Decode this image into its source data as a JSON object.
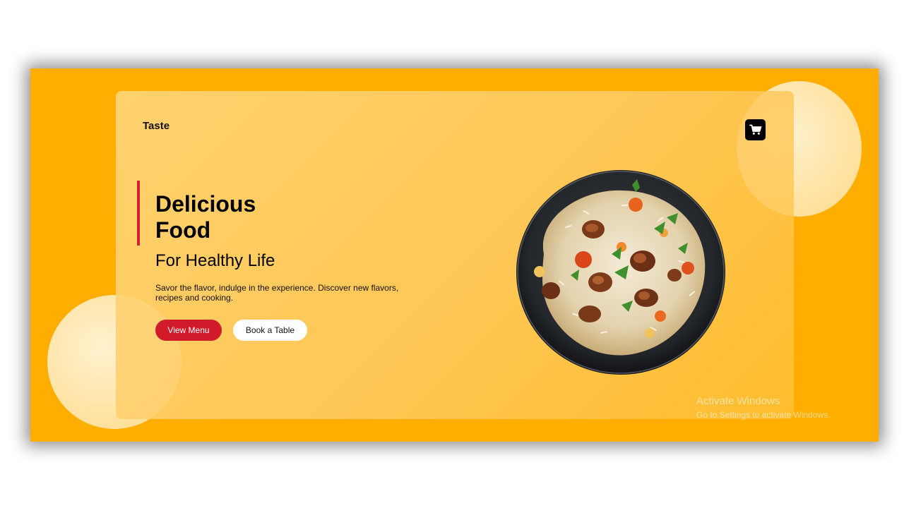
{
  "brand": {
    "name": "Taste"
  },
  "header": {
    "cart_icon": "shopping-cart-icon"
  },
  "hero": {
    "headline_line1": "Delicious",
    "headline_line2": "Food",
    "subtitle": "For Healthy Life",
    "description": "Savor the flavor, indulge in the experience. Discover new flavors, recipes and cooking.",
    "primary_button": "View Menu",
    "secondary_button": "Book a Table"
  },
  "image": {
    "subject": "plate of chicken biryani rice"
  },
  "watermark": {
    "title": "Activate Windows",
    "subtitle": "Go to Settings to activate Windows."
  },
  "colors": {
    "background": "#ffae00",
    "accent": "#d11a2a",
    "cart_button": "#000000",
    "secondary_button": "#ffffff"
  }
}
